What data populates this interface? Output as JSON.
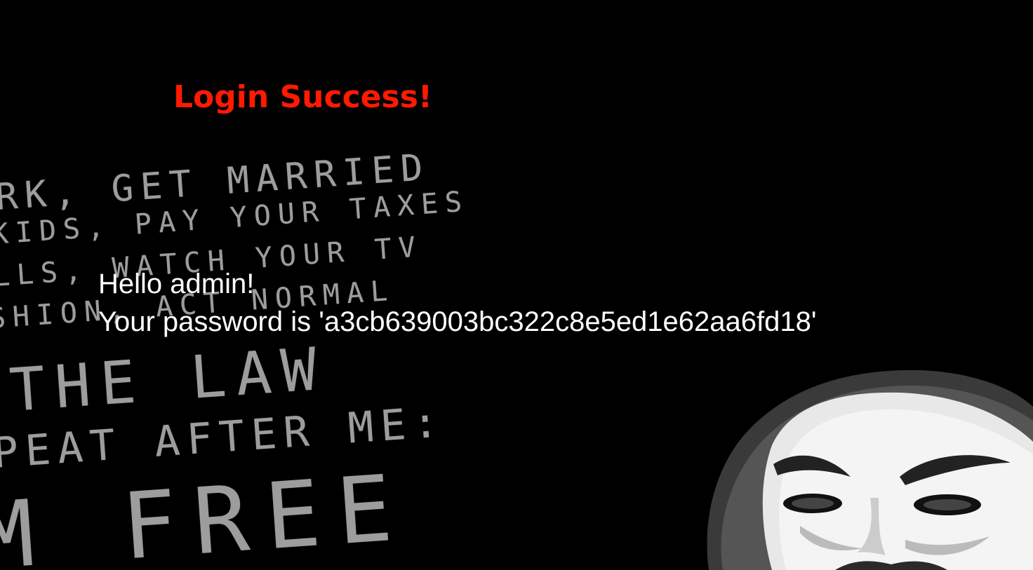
{
  "page": {
    "title": "Login Success!",
    "greeting": "Hello admin!",
    "password_line": "Your password is 'a3cb639003bc322c8e5ed1e62aa6fd18'"
  },
  "background": {
    "lines": [
      "RK, GET MARRIED",
      "KIDS, PAY YOUR TAXES",
      "LLS, WATCH YOUR TV",
      "SHION, ACT NORMAL",
      "THE LAW",
      "PEAT AFTER ME:",
      "M FREE"
    ],
    "image": "guy-fawkes-mask-illustration"
  },
  "colors": {
    "background": "#000000",
    "title": "#ff1a00",
    "message": "#ffffff",
    "poster_text": "#b9b9b9"
  }
}
